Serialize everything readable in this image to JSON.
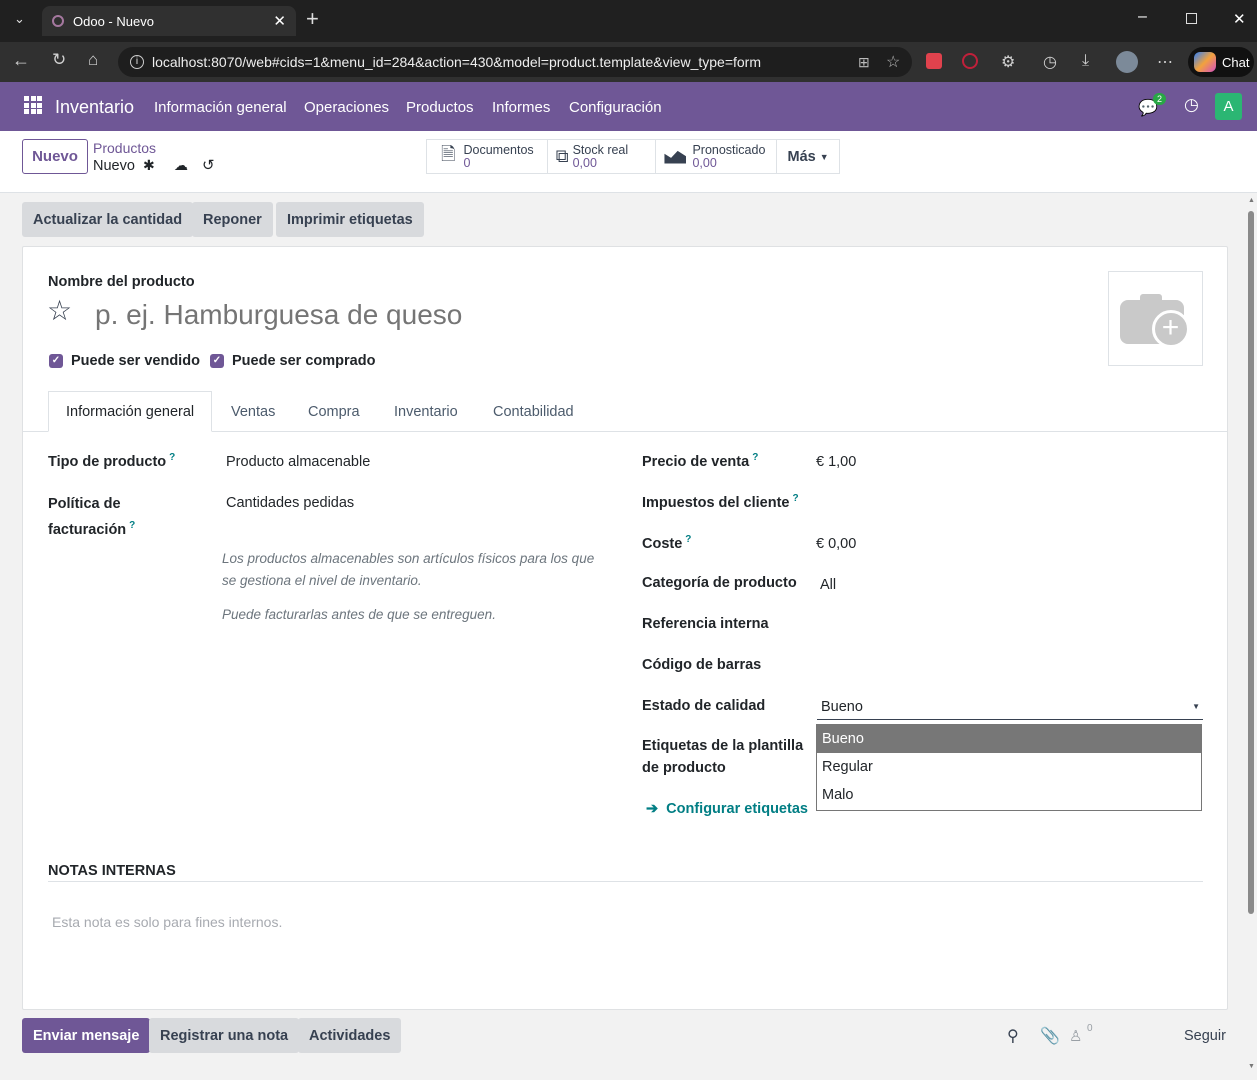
{
  "browser": {
    "tab_title": "Odoo - Nuevo",
    "url": "localhost:8070/web#cids=1&menu_id=284&action=430&model=product.template&view_type=form",
    "chat_label": "Chat"
  },
  "navbar": {
    "app_name": "Inventario",
    "menu": [
      "Información general",
      "Operaciones",
      "Productos",
      "Informes",
      "Configuración"
    ],
    "messages_badge": "2",
    "avatar_letter": "A"
  },
  "control_panel": {
    "new_button": "Nuevo",
    "breadcrumb_parent": "Productos",
    "breadcrumb_current": "Nuevo",
    "smart_buttons": [
      {
        "label": "Documentos",
        "value": "0",
        "icon": "document-icon"
      },
      {
        "label": "Stock real",
        "value": "0,00",
        "icon": "cubes-icon"
      },
      {
        "label": "Pronosticado",
        "value": "0,00",
        "icon": "area-chart-icon"
      }
    ],
    "more_label": "Más"
  },
  "actions": [
    "Actualizar la cantidad",
    "Reponer",
    "Imprimir etiquetas"
  ],
  "form": {
    "name_label": "Nombre del producto",
    "name_placeholder": "p. ej. Hamburguesa de queso",
    "can_be_sold": "Puede ser vendido",
    "can_be_purchased": "Puede ser comprado",
    "tabs": [
      "Información general",
      "Ventas",
      "Compra",
      "Inventario",
      "Contabilidad"
    ],
    "active_tab": "Información general",
    "left": {
      "product_type_label": "Tipo de producto",
      "product_type_value": "Producto almacenable",
      "invoicing_label_1": "Política de",
      "invoicing_label_2": "facturación",
      "invoicing_value": "Cantidades pedidas",
      "help_1_line1": "Los productos almacenables son artículos físicos para los que",
      "help_1_line2": "se gestiona el nivel de inventario.",
      "help_2": "Puede facturarlas antes de que se entreguen."
    },
    "right": {
      "sale_price_label": "Precio de venta",
      "sale_price_value": "€ 1,00",
      "customer_taxes_label": "Impuestos del cliente",
      "cost_label": "Coste",
      "cost_value": "€ 0,00",
      "category_label": "Categoría de producto",
      "category_value": "All",
      "internal_ref_label": "Referencia interna",
      "barcode_label": "Código de barras",
      "quality_label": "Estado de calidad",
      "quality_value": "Bueno",
      "quality_options": [
        "Bueno",
        "Regular",
        "Malo"
      ],
      "tags_label_1": "Etiquetas de la plantilla",
      "tags_label_2": "de producto",
      "configure_tags": "Configurar etiquetas"
    },
    "notes_title": "NOTAS INTERNAS",
    "notes_placeholder": "Esta nota es solo para fines internos."
  },
  "chatter": {
    "send_message": "Enviar mensaje",
    "log_note": "Registrar una nota",
    "activities": "Actividades",
    "followers_count": "0",
    "follow": "Seguir"
  },
  "colors": {
    "navbar": "#6f5796",
    "primary": "#6f5796",
    "link": "#017e84"
  }
}
